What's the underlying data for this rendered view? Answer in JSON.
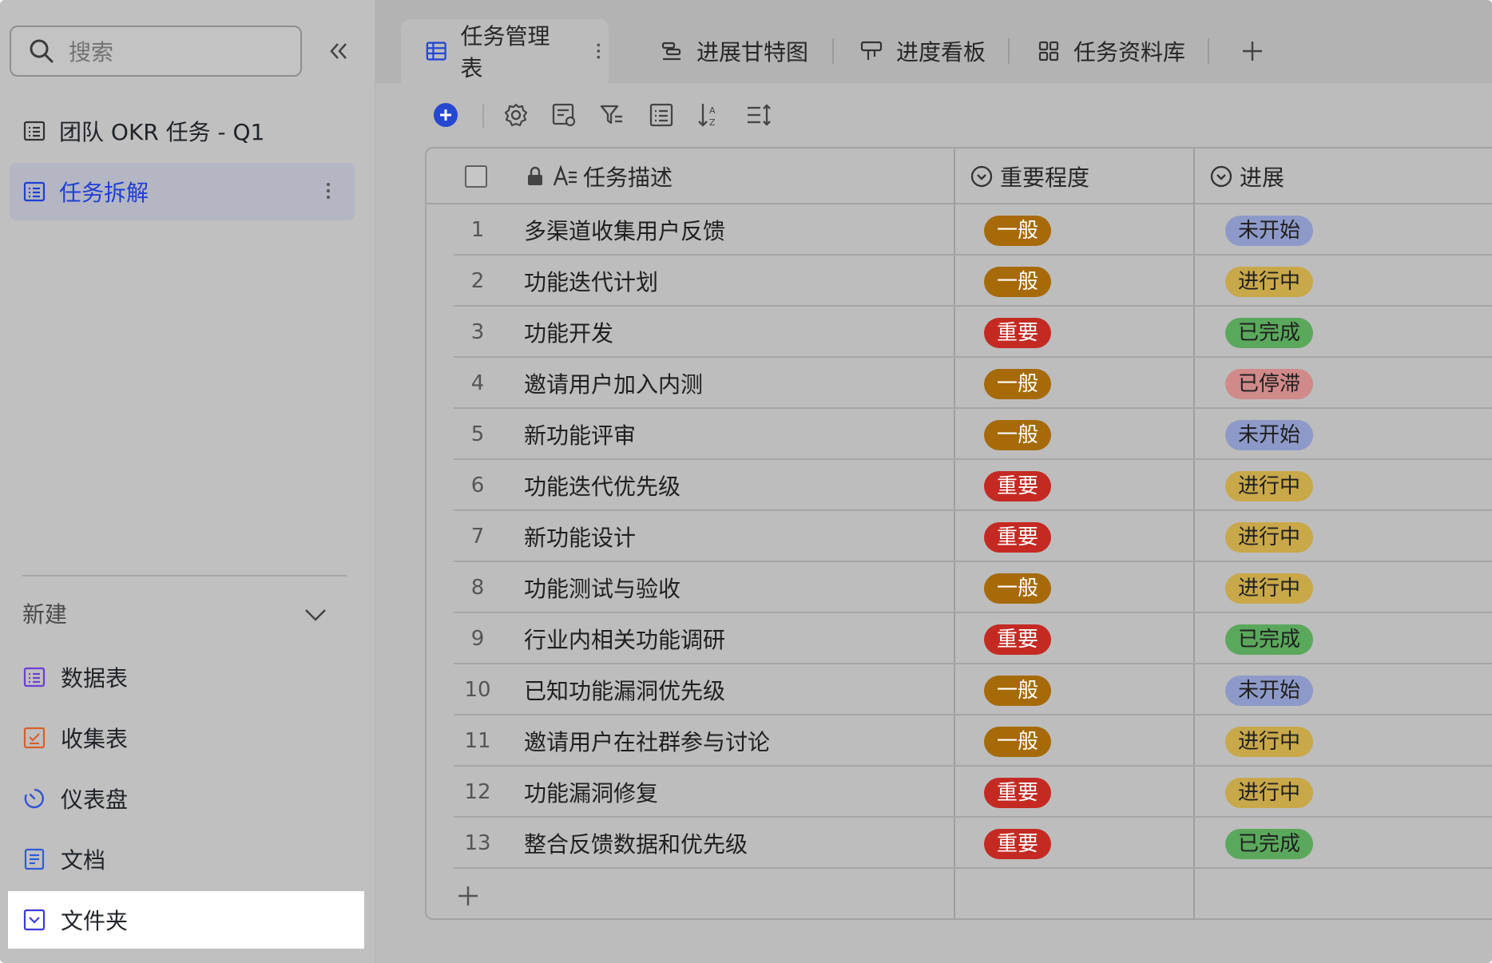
{
  "sidebar": {
    "search_placeholder": "搜索",
    "items": [
      {
        "label": "团队 OKR 任务 - Q1",
        "icon": "table-icon",
        "active": false
      },
      {
        "label": "任务拆解",
        "icon": "table-icon",
        "active": true
      }
    ],
    "new_section": {
      "label": "新建",
      "items": [
        {
          "label": "数据表",
          "icon": "table-icon",
          "color": "#6b3fd4"
        },
        {
          "label": "收集表",
          "icon": "form-icon",
          "color": "#d8602a"
        },
        {
          "label": "仪表盘",
          "icon": "dashboard-icon",
          "color": "#3352d8"
        },
        {
          "label": "文档",
          "icon": "doc-icon",
          "color": "#2f5bd8"
        },
        {
          "label": "文件夹",
          "icon": "folder-icon",
          "color": "#3a3ad8"
        }
      ]
    }
  },
  "tabs": [
    {
      "label": "任务管理表",
      "icon": "grid-table-icon",
      "active": true
    },
    {
      "label": "进展甘特图",
      "icon": "gantt-icon",
      "active": false
    },
    {
      "label": "进度看板",
      "icon": "kanban-icon",
      "active": false
    },
    {
      "label": "任务资料库",
      "icon": "gallery-icon",
      "active": false
    }
  ],
  "columns": {
    "description": "任务描述",
    "importance": "重要程度",
    "progress": "进展"
  },
  "status_colors": {
    "一般": {
      "bg": "#a66a08",
      "fg": "#ffffff"
    },
    "重要": {
      "bg": "#c42a22",
      "fg": "#ffffff"
    },
    "未开始": {
      "bg": "#8d9ac9",
      "fg": "#1f1f1f"
    },
    "进行中": {
      "bg": "#c9a84a",
      "fg": "#1f1f1f"
    },
    "已完成": {
      "bg": "#5aa85c",
      "fg": "#1f1f1f"
    },
    "已停滞": {
      "bg": "#d18a8a",
      "fg": "#1f1f1f"
    }
  },
  "rows": [
    {
      "num": "1",
      "desc": "多渠道收集用户反馈",
      "importance": "一般",
      "progress": "未开始"
    },
    {
      "num": "2",
      "desc": "功能迭代计划",
      "importance": "一般",
      "progress": "进行中"
    },
    {
      "num": "3",
      "desc": "功能开发",
      "importance": "重要",
      "progress": "已完成"
    },
    {
      "num": "4",
      "desc": "邀请用户加入内测",
      "importance": "一般",
      "progress": "已停滞"
    },
    {
      "num": "5",
      "desc": "新功能评审",
      "importance": "一般",
      "progress": "未开始"
    },
    {
      "num": "6",
      "desc": "功能迭代优先级",
      "importance": "重要",
      "progress": "进行中"
    },
    {
      "num": "7",
      "desc": "新功能设计",
      "importance": "重要",
      "progress": "进行中"
    },
    {
      "num": "8",
      "desc": "功能测试与验收",
      "importance": "一般",
      "progress": "进行中"
    },
    {
      "num": "9",
      "desc": "行业内相关功能调研",
      "importance": "重要",
      "progress": "已完成"
    },
    {
      "num": "10",
      "desc": "已知功能漏洞优先级",
      "importance": "一般",
      "progress": "未开始"
    },
    {
      "num": "11",
      "desc": "邀请用户在社群参与讨论",
      "importance": "一般",
      "progress": "进行中"
    },
    {
      "num": "12",
      "desc": "功能漏洞修复",
      "importance": "重要",
      "progress": "进行中"
    },
    {
      "num": "13",
      "desc": "整合反馈数据和优先级",
      "importance": "重要",
      "progress": "已完成"
    }
  ]
}
